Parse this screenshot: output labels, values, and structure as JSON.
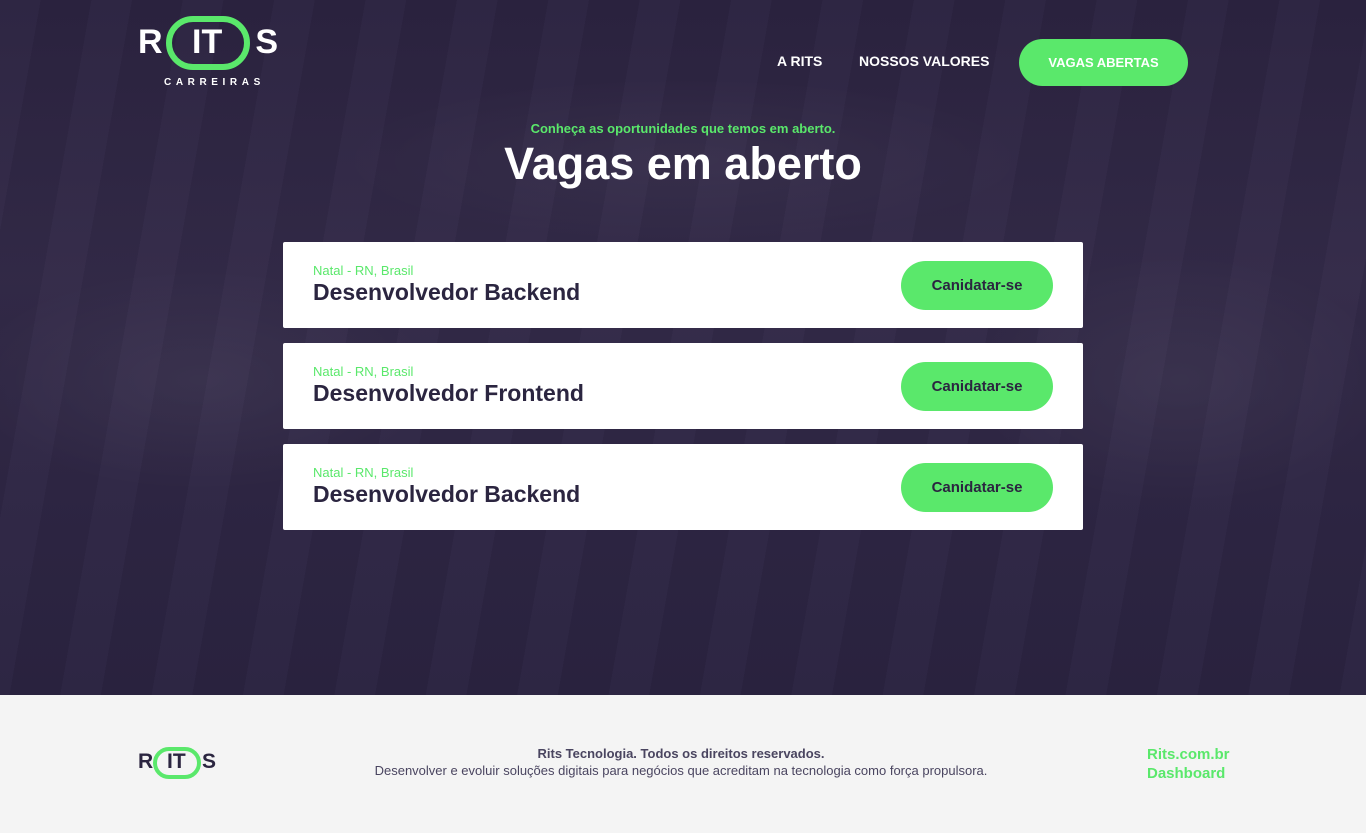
{
  "brand": {
    "name_left": "R",
    "name_mid": "IT",
    "name_right": "S",
    "subtitle": "CARREIRAS",
    "accent": "#5ae86b",
    "dark": "#2b2540"
  },
  "nav": {
    "items": [
      {
        "label": "A RITS"
      },
      {
        "label": "NOSSOS VALORES"
      }
    ],
    "cta_label": "VAGAS ABERTAS"
  },
  "hero": {
    "kicker": "Conheça as oportunidades que temos em aberto.",
    "title": "Vagas em aberto"
  },
  "jobs": [
    {
      "location": "Natal - RN, Brasil",
      "title": "Desenvolvedor Backend",
      "apply_label": "Canidatar-se"
    },
    {
      "location": "Natal - RN, Brasil",
      "title": "Desenvolvedor Frontend",
      "apply_label": "Canidatar-se"
    },
    {
      "location": "Natal - RN, Brasil",
      "title": "Desenvolvedor Backend",
      "apply_label": "Canidatar-se"
    }
  ],
  "footer": {
    "copyright": "Rits Tecnologia. Todos os direitos reservados.",
    "description": "Desenvolver e evoluir soluções digitais para negócios que acreditam na tecnologia como força propulsora.",
    "links": [
      {
        "label": "Rits.com.br"
      },
      {
        "label": "Dashboard"
      }
    ]
  }
}
